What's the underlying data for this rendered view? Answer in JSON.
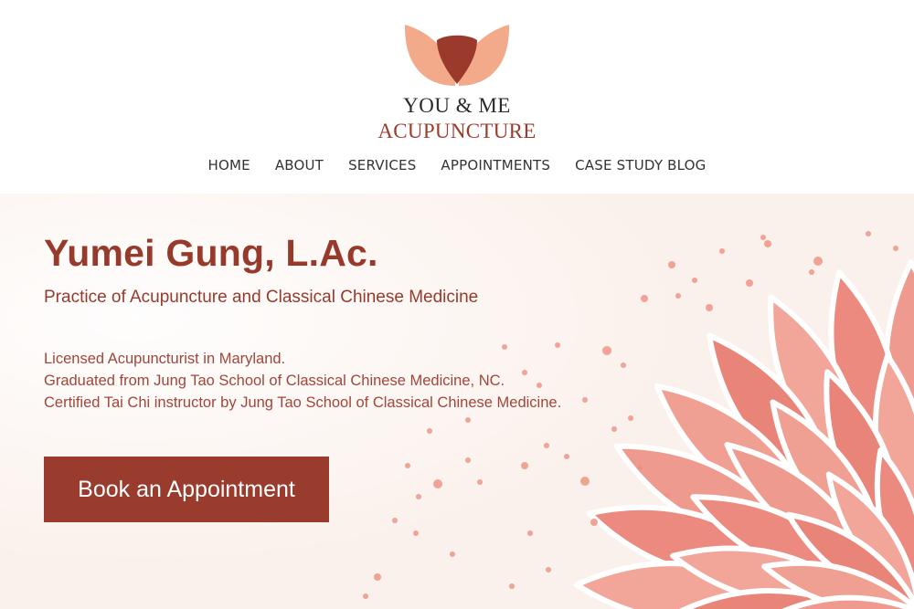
{
  "brand": {
    "line1": "YOU & ME",
    "line2": "ACUPUNCTURE",
    "logo_icon": "lotus-logo-icon"
  },
  "nav": {
    "items": [
      {
        "label": "HOME"
      },
      {
        "label": "ABOUT"
      },
      {
        "label": "SERVICES"
      },
      {
        "label": "APPOINTMENTS"
      },
      {
        "label": "CASE STUDY BLOG"
      }
    ]
  },
  "hero": {
    "title": "Yumei Gung, L.Ac.",
    "subtitle": "Practice of Acupuncture and Classical Chinese Medicine",
    "credentials": [
      "Licensed Acupuncturist in Maryland.",
      "Graduated from Jung Tao School of Classical Chinese Medicine, NC.",
      "Certified Tai Chi instructor by Jung Tao School of Classical Chinese Medicine."
    ],
    "cta_label": "Book an Appointment",
    "decoration": "lotus-flower-illustration"
  },
  "colors": {
    "accent": "#993b2d",
    "petal": "#f0a98d",
    "hero_bg": "#fbf1ec",
    "lotus": "#ec8f86"
  }
}
